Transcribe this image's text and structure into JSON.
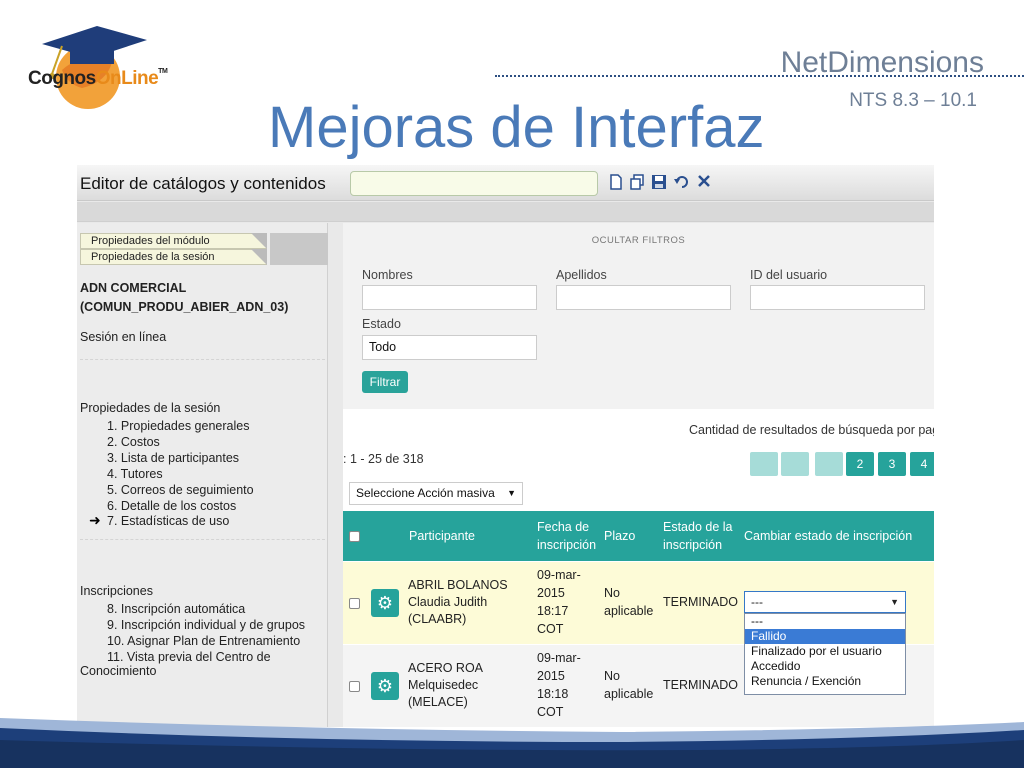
{
  "logo": {
    "brand_text_a": "Cognos",
    "brand_text_b": "OnLine",
    "tm": "TM"
  },
  "header": {
    "brand": "NetDimensions",
    "version": "NTS 8.3 – 10.1",
    "title": "Mejoras de Interfaz"
  },
  "app": {
    "editor_title": "Editor de catálogos y contenidos",
    "toolbar_icons": [
      "new-document-icon",
      "copy-icon",
      "save-icon",
      "undo-icon",
      "close-icon"
    ],
    "left_panel": {
      "tabs": [
        "Propiedades del módulo",
        "Propiedades de la sesión"
      ],
      "session_name_line1": "ADN COMERCIAL",
      "session_name_line2": "(COMUN_PRODU_ABIER_ADN_03)",
      "session_mode": "Sesión en línea",
      "session_props_heading": "Propiedades de la sesión",
      "session_props": [
        "1. Propiedades generales",
        "2. Costos",
        "3. Lista de participantes",
        "4. Tutores",
        "5. Correos de seguimiento",
        "6. Detalle de los costos",
        "7. Estadísticas de uso"
      ],
      "current_item_marker": "➜",
      "enrollments_heading": "Inscripciones",
      "enrollments": [
        "8. Inscripción automática",
        "9. Inscripción individual y de grupos",
        "10. Asignar Plan de Entrenamiento",
        "11. Vista previa del Centro de"
      ],
      "enrollments_wrap": "Conocimiento"
    },
    "filters": {
      "toggle": "OCULTAR FILTROS",
      "names_label": "Nombres",
      "names_value": "",
      "surnames_label": "Apellidos",
      "surnames_value": "",
      "userid_label": "ID del usuario",
      "userid_value": "",
      "status_label": "Estado",
      "status_value": "Todo",
      "filter_button": "Filtrar"
    },
    "results": {
      "per_page_label": "Cantidad de resultados de búsqueda por pagi",
      "count": ": 1 - 25 de 318",
      "pages": [
        "2",
        "3",
        "4"
      ]
    },
    "bulk_action": "Seleccione Acción masiva",
    "table": {
      "headers": {
        "participant": "Participante",
        "date_a": "Fecha de",
        "date_b": "inscripción",
        "term": "Plazo",
        "status_a": "Estado de la",
        "status_b": "inscripción",
        "change": "Cambiar estado de inscripción"
      },
      "rows": [
        {
          "surname": "ABRIL BOLANOS",
          "name": "Claudia Judith",
          "code": "(CLAABR)",
          "date": "09-mar-",
          "year": "2015",
          "time": "18:17",
          "tz": "COT",
          "term_a": "No",
          "term_b": "aplicable",
          "status": "TERMINADO",
          "change": "---"
        },
        {
          "surname": "ACERO ROA",
          "name": "Melquisedec",
          "code": "(MELACE)",
          "date": "09-mar-",
          "year": "2015",
          "time": "18:18",
          "tz": "COT",
          "term_a": "No",
          "term_b": "aplicable",
          "status": "TERMINADO",
          "change": ""
        }
      ],
      "status_options": [
        "---",
        "Fallido",
        "Finalizado por el usuario",
        "Accedido",
        "Renuncia / Exención"
      ]
    }
  },
  "colors": {
    "accent": "#26a39b",
    "title": "#4a7ab8",
    "highlight_row": "#fdfbd7",
    "selected_option": "#3a7bd5"
  }
}
